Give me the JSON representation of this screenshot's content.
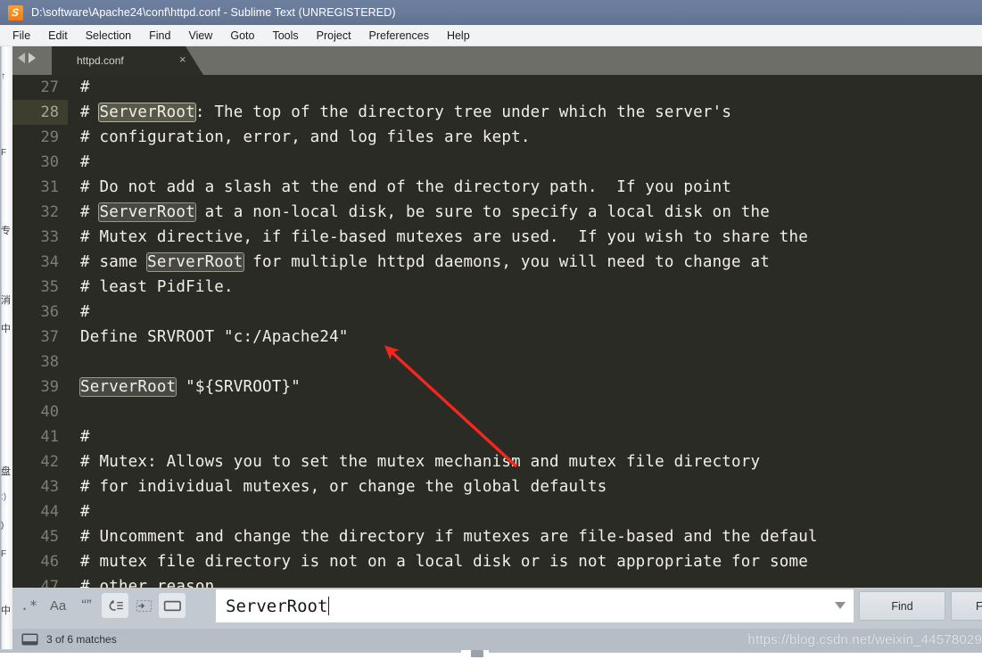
{
  "window": {
    "title": "D:\\software\\Apache24\\conf\\httpd.conf - Sublime Text (UNREGISTERED)",
    "app_icon_letter": "S",
    "icon_color": "#f07d14"
  },
  "menubar": {
    "items": [
      {
        "label": "File"
      },
      {
        "label": "Edit"
      },
      {
        "label": "Selection"
      },
      {
        "label": "Find"
      },
      {
        "label": "View"
      },
      {
        "label": "Goto"
      },
      {
        "label": "Tools"
      },
      {
        "label": "Project"
      },
      {
        "label": "Preferences"
      },
      {
        "label": "Help"
      }
    ]
  },
  "tabs": {
    "active": "httpd.conf",
    "close_glyph": "×"
  },
  "editor": {
    "first_line_number": 27,
    "active_line": 28,
    "search_term": "ServerRoot",
    "lines": [
      {
        "n": 27,
        "text": "#"
      },
      {
        "n": 28,
        "text": "# ServerRoot: The top of the directory tree under which the server's"
      },
      {
        "n": 29,
        "text": "# configuration, error, and log files are kept."
      },
      {
        "n": 30,
        "text": "#"
      },
      {
        "n": 31,
        "text": "# Do not add a slash at the end of the directory path.  If you point"
      },
      {
        "n": 32,
        "text": "# ServerRoot at a non-local disk, be sure to specify a local disk on the"
      },
      {
        "n": 33,
        "text": "# Mutex directive, if file-based mutexes are used.  If you wish to share the"
      },
      {
        "n": 34,
        "text": "# same ServerRoot for multiple httpd daemons, you will need to change at"
      },
      {
        "n": 35,
        "text": "# least PidFile."
      },
      {
        "n": 36,
        "text": "#"
      },
      {
        "n": 37,
        "text": "Define SRVROOT \"c:/Apache24\""
      },
      {
        "n": 38,
        "text": ""
      },
      {
        "n": 39,
        "text": "ServerRoot \"${SRVROOT}\""
      },
      {
        "n": 40,
        "text": ""
      },
      {
        "n": 41,
        "text": "#"
      },
      {
        "n": 42,
        "text": "# Mutex: Allows you to set the mutex mechanism and mutex file directory"
      },
      {
        "n": 43,
        "text": "# for individual mutexes, or change the global defaults"
      },
      {
        "n": 44,
        "text": "#"
      },
      {
        "n": 45,
        "text": "# Uncomment and change the directory if mutexes are file-based and the defaul"
      },
      {
        "n": 46,
        "text": "# mutex file directory is not on a local disk or is not appropriate for some"
      },
      {
        "n": 47,
        "text": "# other reason."
      }
    ]
  },
  "findbar": {
    "tools": [
      {
        "name": "regex-toggle",
        "label": ".*",
        "active": false
      },
      {
        "name": "case-sensitive-toggle",
        "label": "Aa",
        "active": false
      },
      {
        "name": "whole-word-toggle",
        "label": "“”",
        "active": false
      },
      {
        "name": "wrap-toggle",
        "label": "",
        "active": true
      },
      {
        "name": "in-selection-toggle",
        "label": "",
        "active": false
      },
      {
        "name": "highlight-results-toggle",
        "label": "",
        "active": true
      }
    ],
    "query": "ServerRoot",
    "placeholder": "Find",
    "find_button": "Find",
    "find_all_button": "Find All"
  },
  "statusbar": {
    "matches": "3 of 6 matches"
  },
  "watermark": {
    "text": "https://blog.csdn.net/weixin_44578029"
  },
  "background_window": {
    "fragments": [
      "↑",
      "F",
      "专",
      "消",
      "中",
      "盘",
      ":)",
      ")",
      "F",
      "中"
    ]
  },
  "colors": {
    "title_bar": "#6a7b9a",
    "editor_bg": "#2b2b26",
    "editor_fg": "#f2f0e6",
    "gutter_fg": "#7e7e72",
    "active_line_gutter": "#3e3e2f",
    "tab_active": "#2d2d28",
    "tab_strip": "#6e6e68",
    "chrome": "#c3c9d1",
    "annotation_arrow": "#f4271f"
  }
}
